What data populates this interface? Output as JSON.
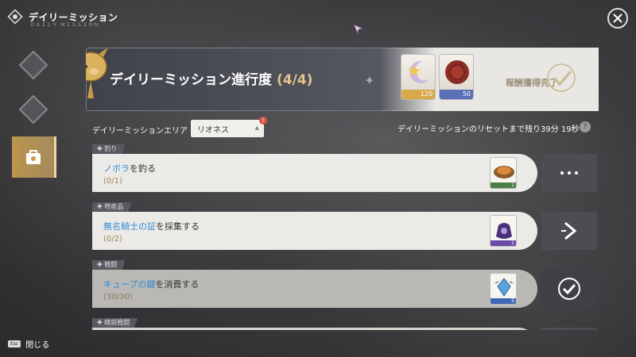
{
  "app": {
    "title": "デイリーミッション",
    "subtitle": "ＤＡＩＬＹ ＭＩＳＳＩＯＮ"
  },
  "sidebar": {
    "items": [
      {
        "icon": "compass-icon",
        "active": false
      },
      {
        "icon": "sword-icon",
        "active": false
      },
      {
        "icon": "mission-bag-icon",
        "active": true
      }
    ]
  },
  "progress": {
    "title": "デイリーミッション進行度",
    "count": "(4/4)",
    "reward_status": "報酬獲得完了"
  },
  "rewards": [
    {
      "icon": "moon-star-icon",
      "count": "120",
      "band_color": "#d8a84a"
    },
    {
      "icon": "wax-seal-icon",
      "count": "50",
      "band_color": "#5a6fb5"
    }
  ],
  "area": {
    "label": "デイリーミッションエリア",
    "value": "リオネス"
  },
  "reset": {
    "text": "デイリーミッションのリセットまで残り39分 19秒"
  },
  "missions": [
    {
      "category": "釣り",
      "name_hl": "ノボラ",
      "name_rest": "を釣る",
      "progress": "(0/1)",
      "item_icon": "fish-dish-icon",
      "item_count": "1",
      "band_color": "#4c7d43",
      "action_icon": "more-icon",
      "done": false
    },
    {
      "category": "特産品",
      "name_hl": "無名騎士の証",
      "name_rest": "を採集する",
      "progress": "(0/2)",
      "item_icon": "pouch-icon",
      "item_count": "1",
      "band_color": "#6a4aa8",
      "action_icon": "go-icon",
      "done": false
    },
    {
      "category": "戦闘",
      "name_hl": "キューブの鍵",
      "name_rest": "を消費する",
      "progress": "(30/30)",
      "item_icon": "crystal-icon",
      "item_count": "5",
      "band_color": "#3f66b2",
      "action_icon": "check-icon",
      "done": true
    },
    {
      "category": "精鋭戦闘",
      "name_hl": "",
      "name_rest": "",
      "progress": "",
      "item_icon": "",
      "item_count": "",
      "band_color": "#3f66b2",
      "action_icon": "",
      "done": false
    }
  ],
  "footer": {
    "esc": "Esc",
    "close_label": "閉じる"
  },
  "colors": {
    "accent_gold": "#e6c48a",
    "link_blue": "#2f8bd8"
  }
}
